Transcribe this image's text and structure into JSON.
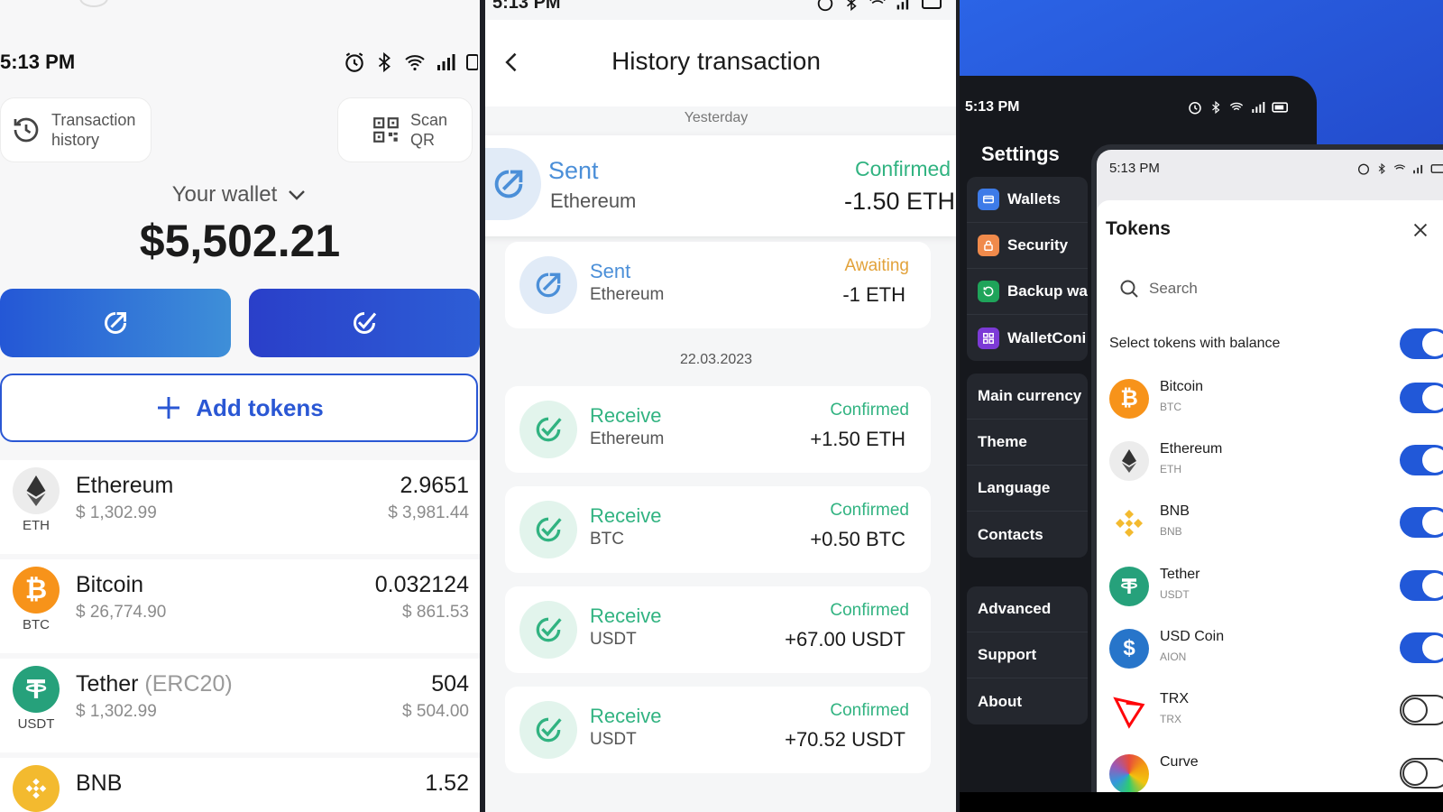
{
  "colors": {
    "brand_blue": "#2a57d4",
    "confirmed_green": "#31b381",
    "awaiting_orange": "#e2a23a",
    "sent_blue": "#4b8fd8",
    "toggle_on": "#2158d8"
  },
  "wallet_screen": {
    "status_time": "5:13 PM",
    "transaction_history_label": "Transaction\nhistory",
    "scan_qr_label": "Scan\nQR",
    "wallet_selector": "Your wallet",
    "balance": "$5,502.21",
    "add_tokens": "Add tokens",
    "tokens": [
      {
        "name": "Ethereum",
        "sub": "",
        "symbol": "ETH",
        "price": "$ 1,302.99",
        "amount": "2.9651",
        "fiat": "$ 3,981.44",
        "icon": "ethereum-icon",
        "color": "#ececec"
      },
      {
        "name": "Bitcoin",
        "sub": "",
        "symbol": "BTC",
        "price": "$ 26,774.90",
        "amount": "0.032124",
        "fiat": "$ 861.53",
        "icon": "bitcoin-icon",
        "color": "#f7931a"
      },
      {
        "name": "Tether",
        "sub": " (ERC20)",
        "symbol": "USDT",
        "price": "$ 1,302.99",
        "amount": "504",
        "fiat": "$ 504.00",
        "icon": "tether-icon",
        "color": "#26a17b"
      },
      {
        "name": "BNB",
        "sub": "",
        "symbol": "",
        "price": "",
        "amount": "1.52",
        "fiat": "",
        "icon": "bnb-icon",
        "color": "#f3ba2f"
      }
    ]
  },
  "history_screen": {
    "status_time": "5:13 PM",
    "title": "History transaction",
    "section_yesterday": "Yesterday",
    "section_date": "22.03.2023",
    "highlighted": {
      "kind": "Sent",
      "asset": "Ethereum",
      "status": "Confirmed",
      "value": "-1.50 ETH"
    },
    "transactions_yesterday": [
      {
        "kind": "Sent",
        "asset": "Ethereum",
        "status": "Awaiting",
        "value": "-1 ETH"
      }
    ],
    "transactions_date": [
      {
        "kind": "Receive",
        "asset": "Ethereum",
        "status": "Confirmed",
        "value": "+1.50 ETH"
      },
      {
        "kind": "Receive",
        "asset": "BTC",
        "status": "Confirmed",
        "value": "+0.50 BTC"
      },
      {
        "kind": "Receive",
        "asset": "USDT",
        "status": "Confirmed",
        "value": "+67.00 USDT"
      },
      {
        "kind": "Receive",
        "asset": "USDT",
        "status": "Confirmed",
        "value": "+70.52 USDT"
      }
    ]
  },
  "settings_screen": {
    "status_time": "5:13 PM",
    "title": "Settings",
    "group1": [
      {
        "label": "Wallets",
        "icon": "wallet-icon",
        "color": "#3d7be8"
      },
      {
        "label": "Security",
        "icon": "lock-icon",
        "color": "#f08a4b"
      },
      {
        "label": "Backup wa",
        "icon": "backup-icon",
        "color": "#1fa45a"
      },
      {
        "label": "WalletConi",
        "icon": "walletconnect-icon",
        "color": "#7c3ad6"
      }
    ],
    "group2": [
      "Main currency",
      "Theme",
      "Language",
      "Contacts"
    ],
    "group3": [
      "Advanced",
      "Support",
      "About"
    ]
  },
  "tokens_modal": {
    "status_time": "5:13 PM",
    "title": "Tokens",
    "search_placeholder": "Search",
    "select_with_balance": "Select tokens with balance",
    "select_with_balance_on": true,
    "tokens": [
      {
        "name": "Bitcoin",
        "symbol": "BTC",
        "enabled": true,
        "icon": "bitcoin-icon",
        "color": "#f7931a"
      },
      {
        "name": "Ethereum",
        "symbol": "ETH",
        "enabled": true,
        "icon": "ethereum-icon",
        "color": "#ececec"
      },
      {
        "name": "BNB",
        "symbol": "BNB",
        "enabled": true,
        "icon": "bnb-icon",
        "color": "#f3ba2f"
      },
      {
        "name": "Tether",
        "symbol": "USDT",
        "enabled": true,
        "icon": "tether-icon",
        "color": "#26a17b"
      },
      {
        "name": "USD Coin",
        "symbol": "AION",
        "enabled": true,
        "icon": "usdcoin-icon",
        "color": "#2775ca"
      },
      {
        "name": "TRX",
        "symbol": "TRX",
        "enabled": false,
        "icon": "trx-icon",
        "color": "#ff060a"
      },
      {
        "name": "Curve",
        "symbol": "",
        "enabled": false,
        "icon": "curve-icon",
        "color": "#e74c3c"
      }
    ]
  }
}
